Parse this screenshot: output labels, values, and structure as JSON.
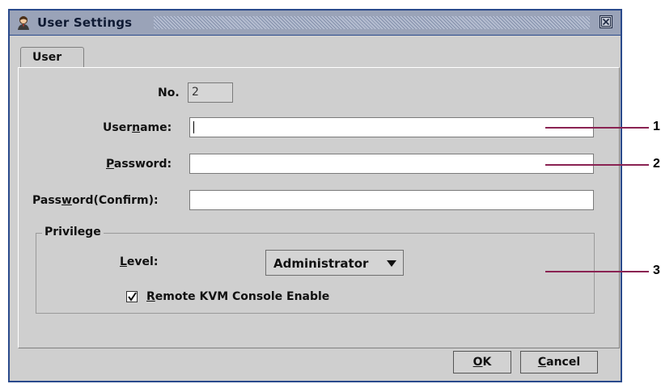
{
  "window": {
    "title": "User Settings",
    "icon": "user-icon",
    "close_icon": "close-icon"
  },
  "tabs": [
    {
      "label": "User"
    }
  ],
  "form": {
    "no_label": "No.",
    "no_value": "2",
    "username_label_pre": "User",
    "username_label_u": "n",
    "username_label_post": "ame:",
    "username_value": "",
    "password_label_u": "P",
    "password_label_post": "assword:",
    "password_value": "",
    "confirm_label_pre": "Pass",
    "confirm_label_u": "w",
    "confirm_label_post": "ord(Confirm):",
    "confirm_value": ""
  },
  "privilege": {
    "group_title": "Privilege",
    "level_label_u": "L",
    "level_label_post": "evel:",
    "level_value": "Administrator",
    "remote_checked": true,
    "remote_label_u": "R",
    "remote_label_post": "emote KVM Console Enable"
  },
  "buttons": {
    "ok_u": "O",
    "ok_post": "K",
    "cancel_u": "C",
    "cancel_post": "ancel"
  },
  "callouts": [
    "1",
    "2",
    "3"
  ],
  "colors": {
    "window_border": "#2a4a8c",
    "callout_line": "#8a2252"
  }
}
